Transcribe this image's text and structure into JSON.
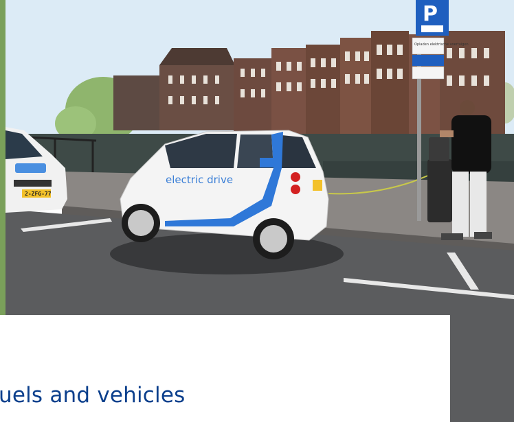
{
  "photo": {
    "car_decal_text": "electric drive",
    "left_car_plate": "2-ZFG-77",
    "parking_sign_letter": "P",
    "parking_sign_subtext": "Opladen elektrische voertuigen"
  },
  "caption": {
    "text": "uels and vehicles"
  },
  "colors": {
    "caption_text": "#0b3f8c",
    "car_accent": "#2f78d8",
    "sign_blue": "#1f5fbf",
    "sky": "#d9ecf8"
  }
}
